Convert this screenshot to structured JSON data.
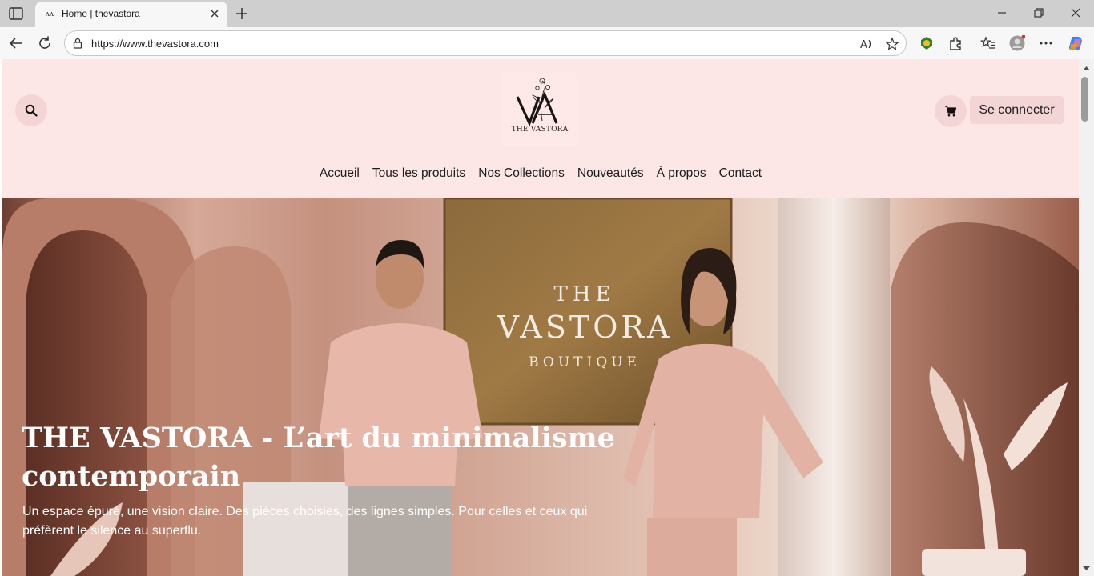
{
  "browser": {
    "tab": {
      "favicon": "ʌʌ",
      "title": "Home | thevastora"
    },
    "url": "https://www.thevastora.com",
    "icons": [
      "sidebar-icon",
      "close-icon",
      "new-tab-icon",
      "minimize-icon",
      "restore-icon",
      "window-close-icon",
      "back-icon",
      "reload-icon",
      "lock-icon",
      "read-aloud-icon",
      "favorite-star-icon",
      "extension-shield-icon",
      "extensions-icon",
      "favorites-icon",
      "profile-icon",
      "more-icon",
      "copilot-icon"
    ]
  },
  "header": {
    "logo_text": "THE VASTORA",
    "login_label": "Se connecter",
    "nav": [
      "Accueil",
      "Tous les produits",
      "Nos Collections",
      "Nouveautés",
      "À propos",
      "Contact"
    ]
  },
  "hero": {
    "sign": {
      "line1": "THE",
      "line2": "VASTORA",
      "line3": "BOUTIQUE"
    },
    "title": "THE VASTORA - L’art du minimalisme contemporain",
    "subtitle": "Un espace épuré, une vision claire. Des pièces choisies, des lignes simples. Pour celles et ceux qui préfèrent le silence au superflu."
  },
  "colors": {
    "header_bg": "#fde6e6",
    "button_bg": "#f4d5d5",
    "text_dark": "#1c1c1c"
  }
}
